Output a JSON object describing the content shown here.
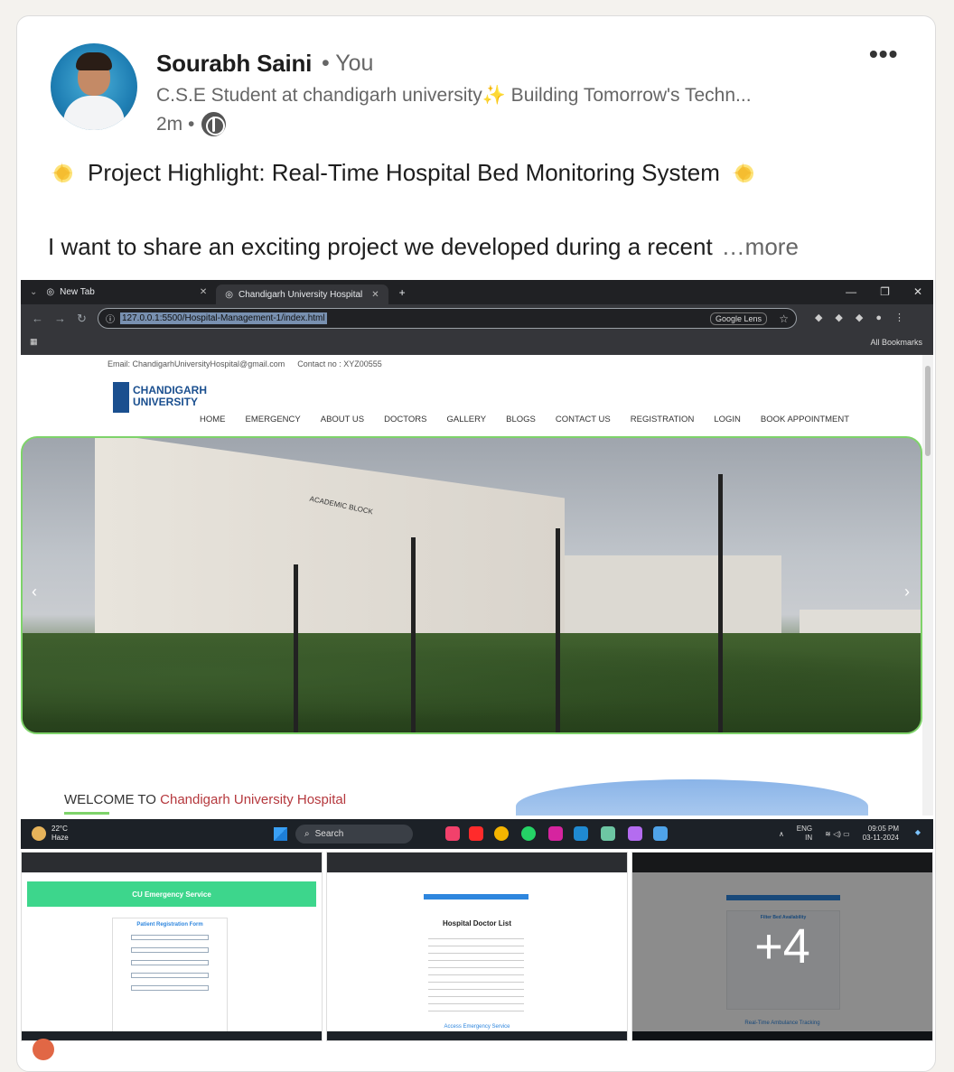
{
  "post": {
    "author_name": "Sourabh Saini",
    "author_badge": "• You",
    "author_headline": "C.S.E Student at chandigarh university✨ Building Tomorrow's Techn...",
    "time": "2m •",
    "menu_icon": "more-horizontal-icon",
    "headline": "Project Highlight: Real-Time Hospital Bed Monitoring System",
    "body_preview": "I want to share an exciting project we developed during a recent",
    "more_label": "…more"
  },
  "screenshot": {
    "tabs": [
      {
        "label": "New Tab"
      },
      {
        "label": "Chandigarh University Hospital"
      }
    ],
    "url": "127.0.0.1:5500/Hospital-Management-1/index.html",
    "google_lens": "Google Lens",
    "all_bookmarks": "All Bookmarks",
    "site": {
      "email": "Email: ChandigarhUniversityHospital@gmail.com",
      "contact": "Contact no : XYZ00555",
      "logo_line1": "CHANDIGARH",
      "logo_line2": "UNIVERSITY",
      "menu": [
        "HOME",
        "EMERGENCY",
        "ABOUT US",
        "DOCTORS",
        "GALLERY",
        "BLOGS",
        "CONTACT US",
        "REGISTRATION",
        "LOGIN",
        "BOOK APPOINTMENT"
      ],
      "hero_sign": "ACADEMIC BLOCK",
      "welcome_prefix": "WELCOME TO",
      "welcome_highlight": "Chandigarh University Hospital"
    },
    "taskbar": {
      "temp": "22°C",
      "weather": "Haze",
      "search": "Search",
      "lang1": "ENG",
      "lang2": "IN",
      "time": "09:05 PM",
      "date": "03-11-2024"
    }
  },
  "thumbnails": {
    "t1_banner": "CU Emergency Service",
    "t1_form_title": "Patient Registration Form",
    "t2_title": "Hospital Doctor List",
    "t2_link": "Access Emergency Service",
    "t3_title": "Filter Bed Availability",
    "t3_footer": "Real-Time Ambulance Tracking",
    "more_count": "+4"
  }
}
